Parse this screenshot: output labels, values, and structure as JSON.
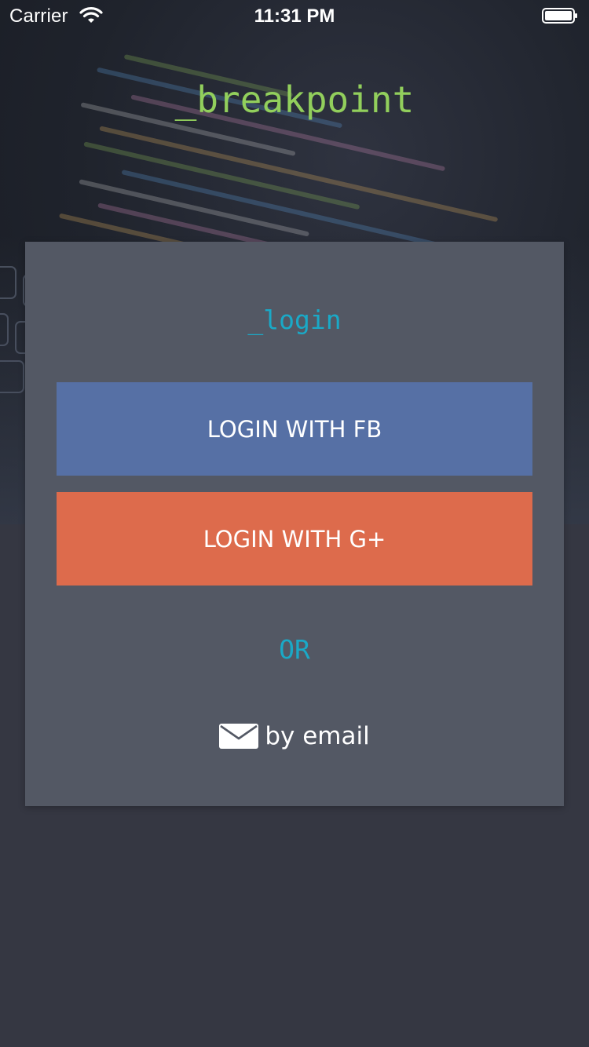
{
  "status_bar": {
    "carrier": "Carrier",
    "time": "11:31 PM",
    "icons": [
      "wifi-icon",
      "battery-icon"
    ]
  },
  "brand": {
    "title": "_breakpoint",
    "color": "#92cf5c"
  },
  "login_card": {
    "title": "_login",
    "facebook_button": "LOGIN WITH FB",
    "google_button": "LOGIN WITH G+",
    "separator": "OR",
    "email_option": "by email",
    "email_icon": "mail-icon"
  },
  "colors": {
    "accent": "#1aa9c7",
    "facebook": "#5670a5",
    "google": "#dd6b4c",
    "card": "#535864",
    "background": "#353742"
  }
}
